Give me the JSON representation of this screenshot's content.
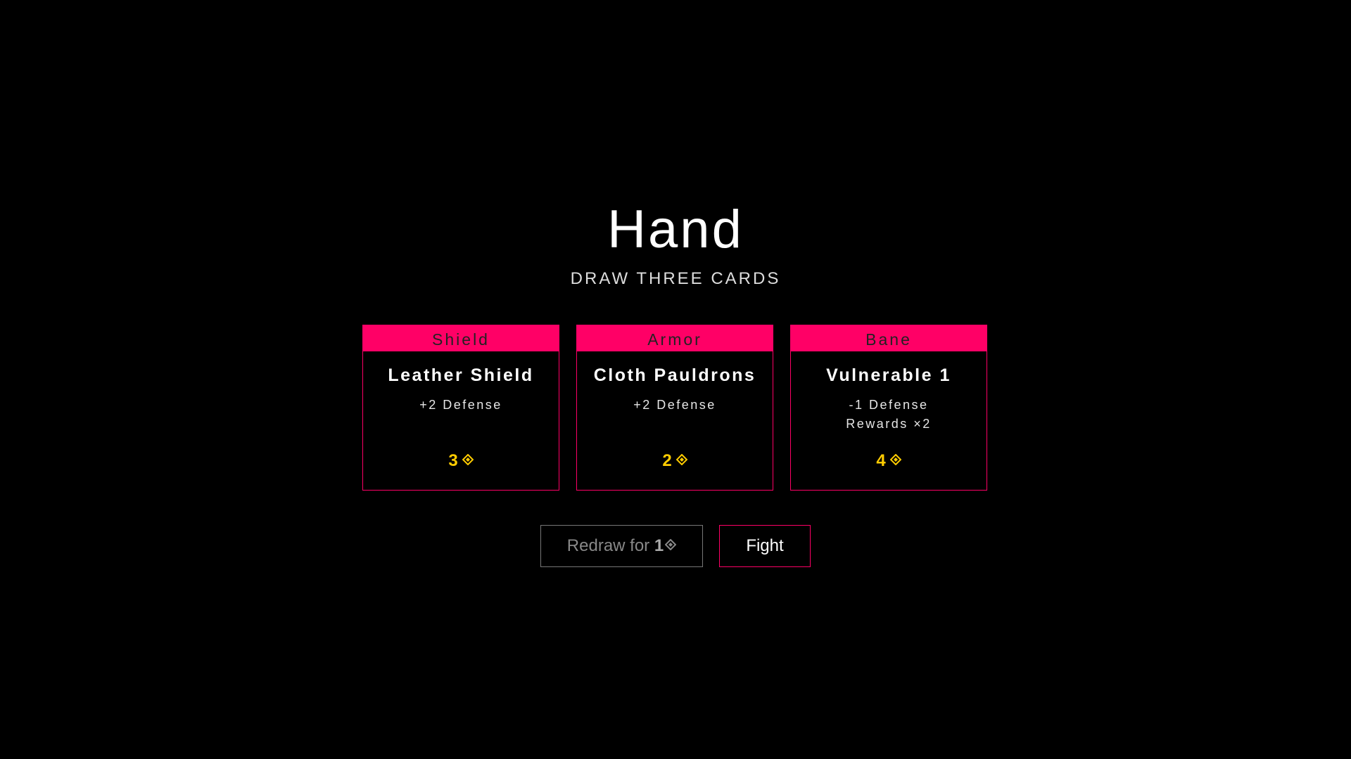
{
  "screen": {
    "title": "Hand",
    "subtitle": "DRAW THREE CARDS"
  },
  "cards": [
    {
      "type": "Shield",
      "name": "Leather Shield",
      "effects": [
        "+2 Defense"
      ],
      "cost": "3",
      "cost_icon": "gem-icon"
    },
    {
      "type": "Armor",
      "name": "Cloth Pauldrons",
      "effects": [
        "+2 Defense"
      ],
      "cost": "2",
      "cost_icon": "gem-icon"
    },
    {
      "type": "Bane",
      "name": "Vulnerable 1",
      "effects": [
        "-1 Defense",
        "Rewards ×2"
      ],
      "cost": "4",
      "cost_icon": "gem-icon"
    }
  ],
  "actions": {
    "redraw_label": "Redraw for ",
    "redraw_cost": "1",
    "redraw_icon": "gem-icon",
    "fight_label": "Fight"
  },
  "colors": {
    "background": "#000000",
    "accent": "#ff0066",
    "cost": "#ffcc00",
    "disabled": "#777777"
  }
}
